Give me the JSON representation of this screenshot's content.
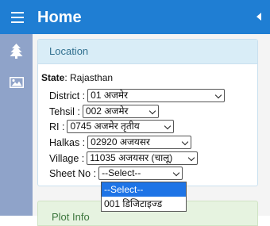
{
  "header": {
    "title": "Home",
    "menu_icon": "hamburger-icon",
    "collapse_icon": "caret-left-icon",
    "background_color": "#1f7ed3"
  },
  "sidebar": {
    "background_color": "#8fa3c9",
    "items": [
      {
        "icon": "tree-icon"
      },
      {
        "icon": "image-icon"
      }
    ]
  },
  "location_panel": {
    "heading": "Location",
    "state_label": "State",
    "state_value": ": Rajasthan",
    "fields": {
      "district": {
        "label": "District :",
        "value": "01 अजमेर"
      },
      "tehsil": {
        "label": "Tehsil :",
        "value": "002 अजमेर"
      },
      "ri": {
        "label": "RI :",
        "value": "0745 अजमेर तृतीय"
      },
      "halkas": {
        "label": "Halkas :",
        "value": "02920 अजयसर"
      },
      "village": {
        "label": "Village :",
        "value": "11035 अजयसर (चालू)"
      },
      "sheet_no": {
        "label": "Sheet No :",
        "value": "--Select--"
      }
    }
  },
  "sheet_dropdown": {
    "options": [
      "--Select--",
      "001 डिजिटाइज्ड"
    ],
    "highlighted_option": "--Select--",
    "highlight_color": "#1e74e6"
  },
  "plot_info_panel": {
    "heading": "Plot Info"
  }
}
